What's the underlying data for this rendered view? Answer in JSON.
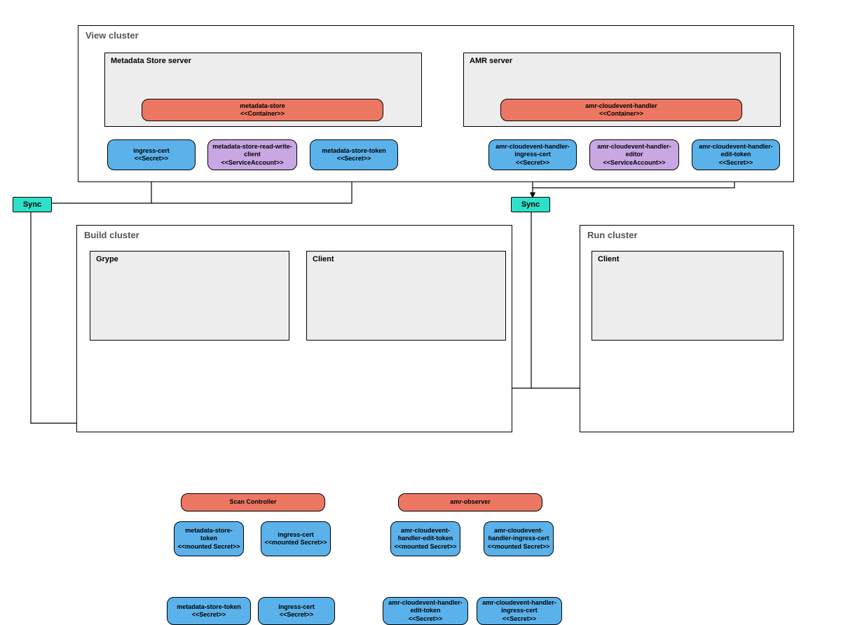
{
  "clusters": {
    "view": {
      "label": "View cluster"
    },
    "build": {
      "label": "Build cluster"
    },
    "run": {
      "label": "Run cluster"
    }
  },
  "subs": {
    "metadata_server": {
      "label": "Metadata Store server"
    },
    "amr_server": {
      "label": "AMR server"
    },
    "grype": {
      "label": "Grype"
    },
    "build_client": {
      "label": "Client"
    },
    "run_client": {
      "label": "Client"
    }
  },
  "nodes": {
    "metadata_store_container": {
      "l1": "metadata-store",
      "l2": "<<Container>>"
    },
    "amr_handler_container": {
      "l1": "amr-cloudevent-handler",
      "l2": "<<Container>>"
    },
    "ingress_cert_secret": {
      "l1": "ingress-cert",
      "l2": "<<Secret>>"
    },
    "metadata_store_rw_client": {
      "l1": "metadata-store-read-write-client",
      "l2": "<<ServiceAccount>>"
    },
    "metadata_store_token": {
      "l1": "metadata-store-token",
      "l2": "<<Secret>>"
    },
    "amr_handler_ingress_cert": {
      "l1": "amr-cloudevent-handler-ingress-cert",
      "l2": "<<Secret>>"
    },
    "amr_handler_editor": {
      "l1": "amr-cloudevent-handler-editor",
      "l2": "<<ServiceAccount>>"
    },
    "amr_handler_edit_token": {
      "l1": "amr-cloudevent-handler-edit-token",
      "l2": "<<Secret>>"
    },
    "scan_controller": {
      "l1": "Scan Controller",
      "l2": ""
    },
    "build_amr_observer": {
      "l1": "amr-observer",
      "l2": ""
    },
    "run_amr_observer": {
      "l1": "amr-observer",
      "l2": ""
    },
    "grype_mst_mounted": {
      "l1": "metadata-store-token",
      "l2": "<<mounted Secret>>"
    },
    "grype_ingress_mounted": {
      "l1": "ingress-cert",
      "l2": "<<mounted Secret>>"
    },
    "build_cli_edit_mounted": {
      "l1": "amr-cloudevent-handler-edit-token",
      "l2": "<<mounted Secret>>"
    },
    "build_cli_ingress_mounted": {
      "l1": "amr-cloudevent-handler-ingress-cert",
      "l2": "<<mounted Secret>>"
    },
    "run_cli_edit_mounted": {
      "l1": "amr-cloudevent-handler-edit-token",
      "l2": "<<mounted Secret>>"
    },
    "run_cli_ingress_mounted": {
      "l1": "amr-cloudevent-handler-ingress-cert",
      "l2": "<<mounted Secret>>"
    },
    "build_mst_secret": {
      "l1": "metadata-store-token",
      "l2": "<<Secret>>"
    },
    "build_ingress_secret": {
      "l1": "ingress-cert",
      "l2": "<<Secret>>"
    },
    "build_amr_edit_secret": {
      "l1": "amr-cloudevent-handler-edit-token",
      "l2": "<<Secret>>"
    },
    "build_amr_ingress_secret": {
      "l1": "amr-cloudevent-handler-ingress-cert",
      "l2": "<<Secret>>"
    },
    "run_amr_edit_secret": {
      "l1": "amr-cloudevent-handler-edit-token",
      "l2": "<<Secret>>"
    },
    "run_amr_ingress_secret": {
      "l1": "amr-cloudevent-handler-ingress-cert",
      "l2": "<<Secret>>"
    }
  },
  "sync": {
    "left": "Sync",
    "center": "Sync"
  }
}
